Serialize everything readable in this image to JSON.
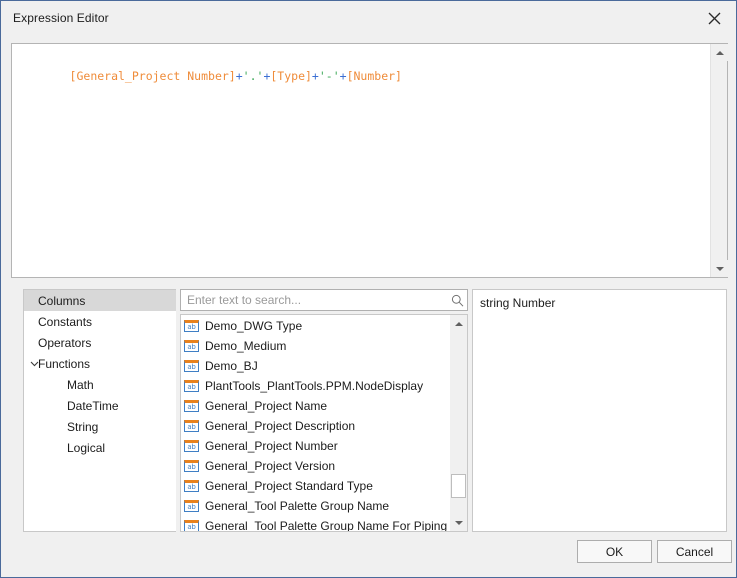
{
  "window": {
    "title": "Expression Editor",
    "close_icon": "close-icon",
    "border_color": "#4a6a9b",
    "background": "#f0f0f0"
  },
  "expression": {
    "full_text": "[General_Project Number]+'.'+[Type]+'-'+[Number]",
    "tokens": [
      {
        "text": "[General_Project Number]",
        "type": "identifier"
      },
      {
        "text": "+",
        "type": "operator"
      },
      {
        "text": "'.'",
        "type": "string"
      },
      {
        "text": "+",
        "type": "operator"
      },
      {
        "text": "[Type]",
        "type": "identifier"
      },
      {
        "text": "+",
        "type": "operator"
      },
      {
        "text": "'-'",
        "type": "string"
      },
      {
        "text": "+",
        "type": "operator"
      },
      {
        "text": "[Number]",
        "type": "identifier"
      }
    ],
    "colors": {
      "identifier": "#ef8c3a",
      "operator": "#3b6fd4",
      "string": "#3faa5a"
    },
    "scrollbar": {
      "up_icon": "scroll-up-icon",
      "down_icon": "scroll-down-icon"
    }
  },
  "tree": {
    "items": [
      {
        "label": "Columns",
        "selected": true,
        "child": false,
        "expandable": false
      },
      {
        "label": "Constants",
        "selected": false,
        "child": false,
        "expandable": false
      },
      {
        "label": "Operators",
        "selected": false,
        "child": false,
        "expandable": false
      },
      {
        "label": "Functions",
        "selected": false,
        "child": false,
        "expandable": true,
        "expanded": true
      },
      {
        "label": "Math",
        "selected": false,
        "child": true,
        "expandable": false
      },
      {
        "label": "DateTime",
        "selected": false,
        "child": true,
        "expandable": false
      },
      {
        "label": "String",
        "selected": false,
        "child": true,
        "expandable": false
      },
      {
        "label": "Logical",
        "selected": false,
        "child": true,
        "expandable": false
      }
    ]
  },
  "search": {
    "value": "",
    "placeholder": "Enter text to search...",
    "icon": "search-icon"
  },
  "list": {
    "item_icon": "ab-text-column-icon",
    "items": [
      {
        "label": "Demo_DWG Type"
      },
      {
        "label": "Demo_Medium"
      },
      {
        "label": "Demo_BJ"
      },
      {
        "label": "PlantTools_PlantTools.PPM.NodeDisplay"
      },
      {
        "label": "General_Project Name"
      },
      {
        "label": "General_Project Description"
      },
      {
        "label": "General_Project Number"
      },
      {
        "label": "General_Project Version"
      },
      {
        "label": "General_Project Standard Type"
      },
      {
        "label": "General_Tool Palette Group Name"
      },
      {
        "label": "General_Tool Palette Group Name For Piping"
      }
    ],
    "scrollbar": {
      "up_icon": "scroll-up-icon",
      "down_icon": "scroll-down-icon"
    }
  },
  "detail": {
    "text": "string Number"
  },
  "footer": {
    "ok_label": "OK",
    "cancel_label": "Cancel"
  }
}
